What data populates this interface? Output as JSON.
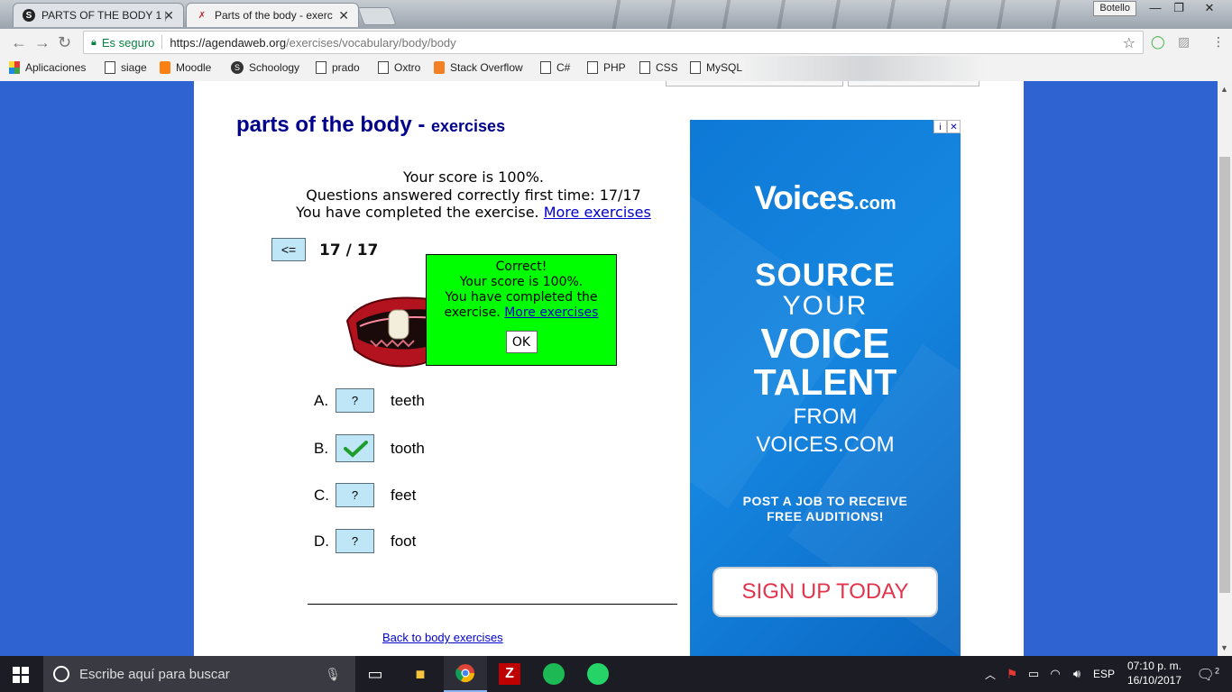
{
  "browser": {
    "tabs": [
      {
        "title": "PARTS OF THE BODY 1 |",
        "icon": "schoology-icon"
      },
      {
        "title": "Parts of the body - exerc",
        "icon": "agendaweb-icon"
      }
    ],
    "profile_name": "Botello",
    "security_label": "Es seguro",
    "url_host": "https://agendaweb.org",
    "url_path": "/exercises/vocabulary/body/body",
    "bookmarks": [
      "Aplicaciones",
      "siage",
      "Moodle",
      "Schoology",
      "prado",
      "Oxtro",
      "Stack Overflow",
      "C#",
      "PHP",
      "CSS",
      "MySQL"
    ]
  },
  "page": {
    "title": "parts of the body - ",
    "title_sub": "exercises",
    "score_line": "Your score is 100%.",
    "correct_line": "Questions answered correctly first time: 17/17",
    "completed_line": "You have completed the exercise. ",
    "more_link": "More exercises",
    "prev_button": "<=",
    "counter": "17 / 17",
    "popup": {
      "correct": "Correct!",
      "score": "Your score is 100%.",
      "completed": "You have completed the exercise. ",
      "more_link": "More exercises",
      "ok": "OK"
    },
    "options": [
      {
        "letter": "A.",
        "mark": "?",
        "text": "teeth"
      },
      {
        "letter": "B.",
        "mark": "check",
        "text": "tooth"
      },
      {
        "letter": "C.",
        "mark": "?",
        "text": "feet"
      },
      {
        "letter": "D.",
        "mark": "?",
        "text": "foot"
      }
    ],
    "back_link": "Back to body exercises"
  },
  "ad": {
    "badge_info": "i",
    "badge_close": "✕",
    "brand": "Voices",
    "brand_suffix": ".com",
    "line1": "SOURCE",
    "line2": "YOUR",
    "line3": "VOICE",
    "line4": "TALENT",
    "line5": "FROM",
    "line6": "VOICES.COM",
    "small1": "POST A JOB TO RECEIVE",
    "small2": "FREE AUDITIONS!",
    "cta": "SIGN UP TODAY"
  },
  "taskbar": {
    "search_placeholder": "Escribe aquí para buscar",
    "language": "ESP",
    "time": "07:10 p. m.",
    "date": "16/10/2017",
    "notifications": "2"
  },
  "colors": {
    "page_bg": "#2f63d2",
    "heading": "#00008b",
    "popup_bg": "#00ff00",
    "answer_box": "#bfe6f7",
    "ad_bg": "#1586e0",
    "cta_text": "#e3344d"
  }
}
